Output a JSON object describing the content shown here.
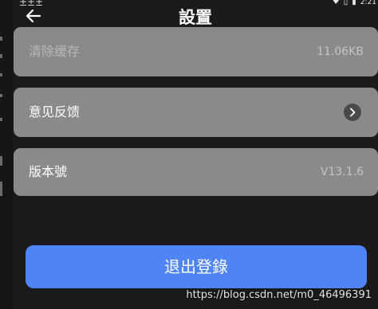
{
  "header": {
    "title": "設置",
    "back_icon": "arrow-left-icon"
  },
  "status_bar": {
    "time": "2:21",
    "glyphs": [
      "±",
      "±",
      "±"
    ]
  },
  "settings": {
    "items": [
      {
        "label": "清除缓存",
        "value": "11.06KB",
        "enabled": false
      },
      {
        "label": "意见反馈",
        "icon": "chevron-right-icon"
      },
      {
        "label": "版本號",
        "value": "V13.1.6"
      }
    ]
  },
  "actions": {
    "logout_label": "退出登錄"
  },
  "watermark": {
    "text": "https://blog.csdn.net/m0_46496391"
  },
  "colors": {
    "background": "#1b1b1d",
    "card": "#8a8a8a",
    "accent": "#4f84f7"
  }
}
